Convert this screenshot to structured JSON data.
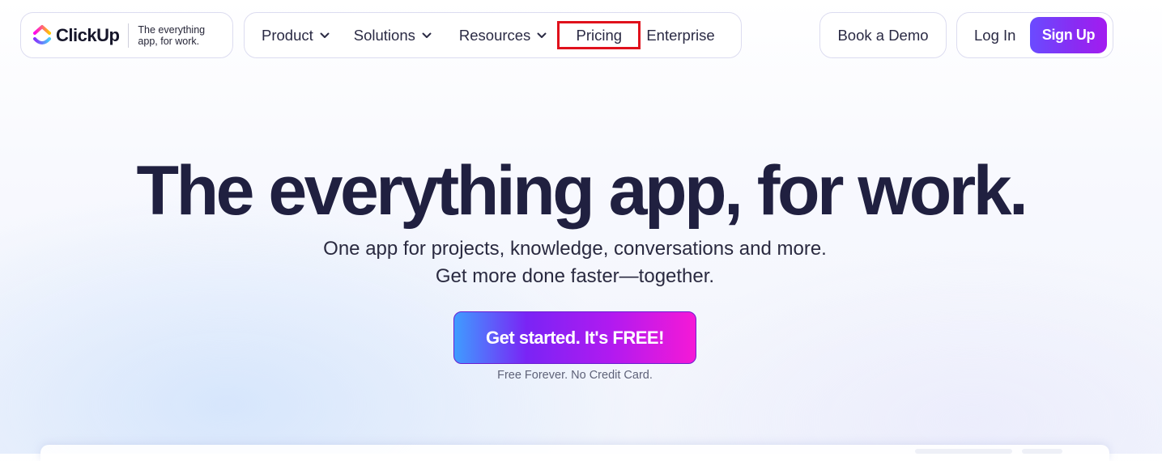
{
  "brand": {
    "name": "ClickUp",
    "tagline_line1": "The everything",
    "tagline_line2": "app, for work.",
    "colors": {
      "purple": "#7b5cff",
      "pink": "#ff02f0",
      "yellow": "#ffc800",
      "blue": "#49ccf9"
    }
  },
  "nav": {
    "items": [
      {
        "label": "Product",
        "has_dropdown": true
      },
      {
        "label": "Solutions",
        "has_dropdown": true
      },
      {
        "label": "Resources",
        "has_dropdown": true
      },
      {
        "label": "Pricing",
        "has_dropdown": false,
        "highlighted": true
      },
      {
        "label": "Enterprise",
        "has_dropdown": false
      }
    ],
    "highlight_color": "#e0111c"
  },
  "header_actions": {
    "demo_label": "Book a Demo",
    "login_label": "Log In",
    "signup_label": "Sign Up"
  },
  "hero": {
    "title": "The everything app, for work.",
    "subtitle_line1": "One app for projects, knowledge, conversations and more.",
    "subtitle_line2": "Get more done faster—together.",
    "cta_label": "Get started. It's FREE!",
    "cta_note": "Free Forever. No Credit Card."
  }
}
